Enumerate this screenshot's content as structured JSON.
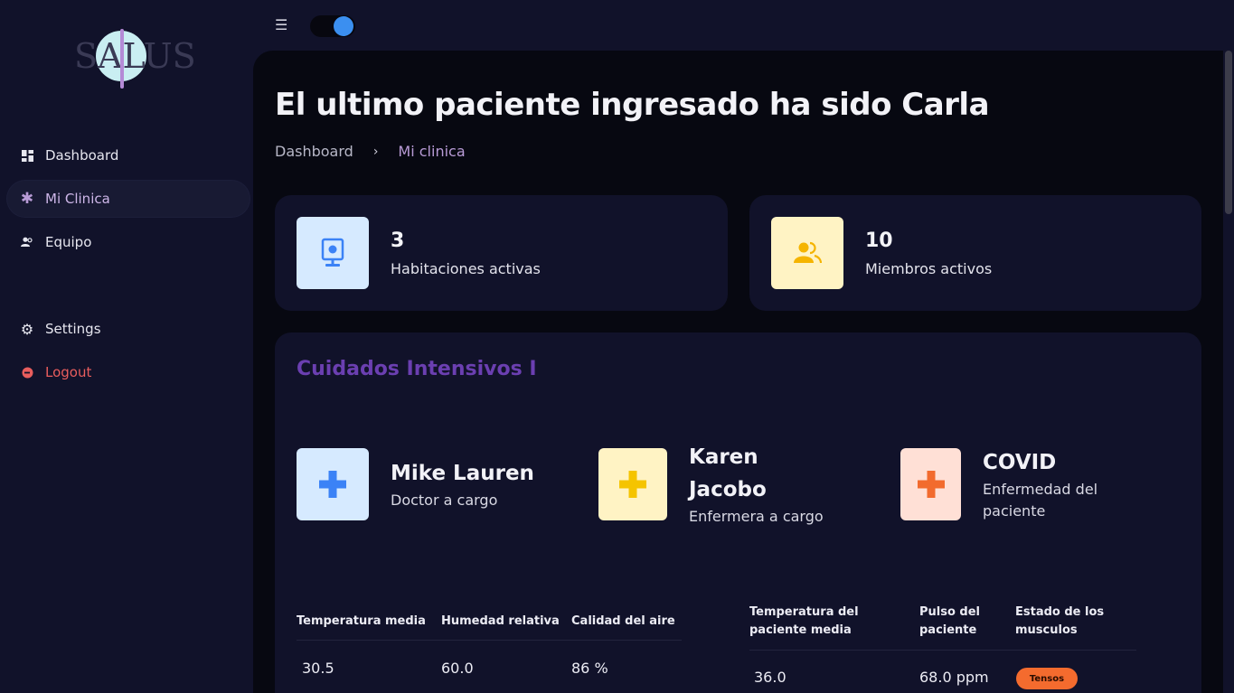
{
  "app": {
    "logo_text": "SALUS"
  },
  "sidebar": {
    "items": [
      {
        "label": "Dashboard"
      },
      {
        "label": "Mi Clinica"
      },
      {
        "label": "Equipo"
      },
      {
        "label": "Settings"
      },
      {
        "label": "Logout"
      }
    ]
  },
  "topbar": {
    "menu_icon": "☰"
  },
  "header": {
    "title": "El ultimo paciente ingresado ha sido Carla",
    "breadcrumb": {
      "root": "Dashboard",
      "separator": "›",
      "current": "Mi clinica"
    }
  },
  "stats": [
    {
      "value": "3",
      "label": "Habitaciones activas",
      "icon": "monitor-icon",
      "bg": "#d6eaff",
      "fg": "#3b82f6"
    },
    {
      "value": "10",
      "label": "Miembros activos",
      "icon": "users-icon",
      "bg": "#fff3c4",
      "fg": "#f5b400"
    }
  ],
  "unit": {
    "title": "Cuidados Intensivos I",
    "people": [
      {
        "name": "Mike Lauren",
        "role": "Doctor a cargo",
        "bg": "#d6eaff",
        "fg": "#3b82f6"
      },
      {
        "name": "Karen Jacobo",
        "role": "Enfermera a cargo",
        "bg": "#fff3c4",
        "fg": "#f5c400"
      },
      {
        "name": "COVID",
        "role": "Enfermedad del paciente",
        "bg": "#ffe0d6",
        "fg": "#f26b2e"
      }
    ],
    "room_table": {
      "headers": [
        "Temperatura media",
        "Humedad relativa",
        "Calidad del aire"
      ],
      "row": [
        "30.5",
        "60.0",
        "86 %"
      ]
    },
    "patient_table": {
      "headers": [
        "Temperatura del paciente media",
        "Pulso del paciente",
        "Estado de los musculos"
      ],
      "row": [
        "36.0",
        "68.0 ppm"
      ],
      "badge": "Tensos"
    }
  },
  "colors": {
    "accent": "#3b8ff0",
    "section_title": "#6b3fb1",
    "logout": "#e85d5d",
    "badge": "#f46b2e"
  }
}
